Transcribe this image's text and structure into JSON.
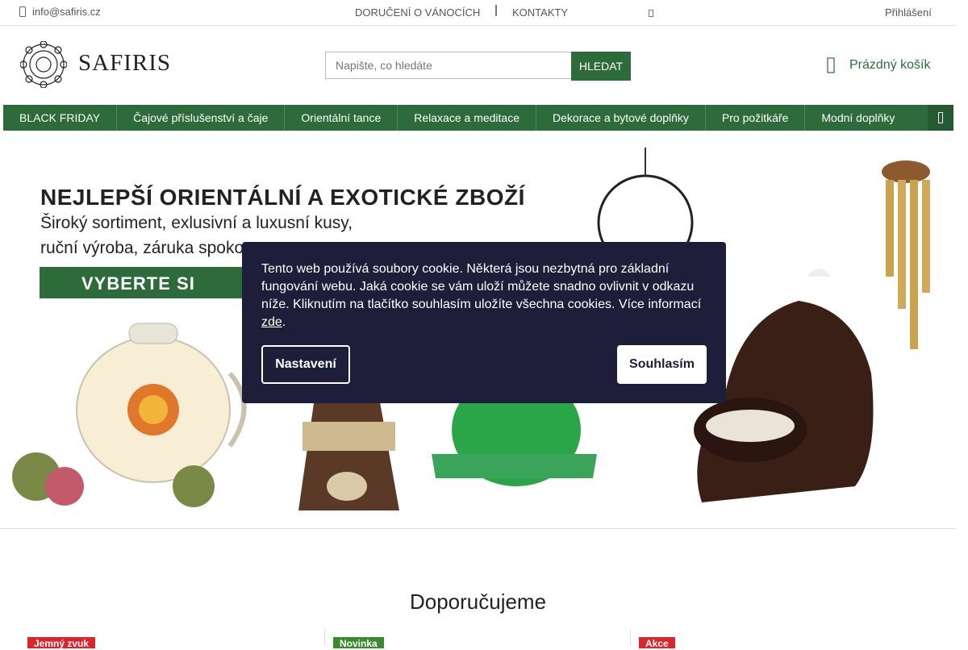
{
  "topbar": {
    "email": "info@safiris.cz",
    "christmas_link": "DORUČENÍ O VÁNOCÍCH",
    "contacts_link": "KONTAKTY",
    "login_link": "Přihlášení"
  },
  "header": {
    "logo_text": "SAFIRIS",
    "search_placeholder": "Napište, co hledáte",
    "search_button": "HLEDAT",
    "cart_label": "Prázdný košík"
  },
  "nav": {
    "items": [
      {
        "label": "BLACK FRIDAY"
      },
      {
        "label": "Čajové příslušenství a čaje"
      },
      {
        "label": "Orientální tance"
      },
      {
        "label": "Relaxace a meditace"
      },
      {
        "label": "Dekorace a bytové doplňky"
      },
      {
        "label": "Pro požitkáře"
      },
      {
        "label": "Modní doplňky"
      }
    ]
  },
  "banner": {
    "title": "NEJLEPŠÍ ORIENTÁLNÍ A EXOTICKÉ ZBOŽÍ",
    "subtitle1": "Široký sortiment, exlusivní a luxusní kusy,",
    "subtitle2": "ruční výroba, záruka spoko",
    "cta": "VYBERTE SI"
  },
  "cookie": {
    "text": "Tento web používá soubory cookie. Některá jsou nezbytná pro základní fungování webu. Jaká cookie se vám uloží můžete snadno ovlivnit v odkazu níže. Kliknutím na tlačítko souhlasím uložíte všechna cookies. Více informací",
    "link": "zde",
    "settings_button": "Nastavení",
    "agree_button": "Souhlasím"
  },
  "recommend": {
    "title": "Doporučujeme",
    "badges": [
      "Jemný zvuk",
      "Novinka",
      "Akce"
    ],
    "badge_colors": [
      "#d9262d",
      "#3a8a2e",
      "#d9262d"
    ]
  },
  "colors": {
    "brand_green": "#2e6b3a",
    "cookie_bg": "#1e1d3a"
  }
}
